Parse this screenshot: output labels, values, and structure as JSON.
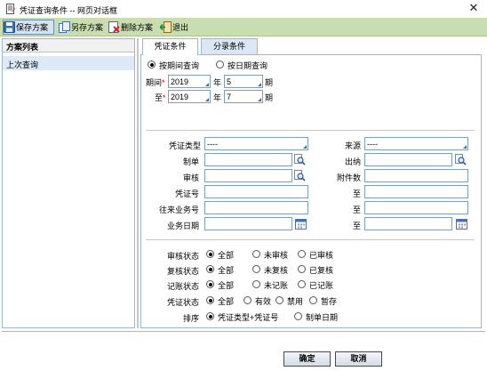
{
  "window": {
    "title": "凭证查询条件 -- 网页对话框",
    "close_glyph": "✕"
  },
  "toolbar": {
    "save": "保存方案",
    "save_as": "另存方案",
    "delete": "删除方案",
    "exit": "退出"
  },
  "sidebar": {
    "header": "方案列表",
    "items": [
      {
        "label": "上次查询"
      }
    ]
  },
  "tabs": [
    {
      "label": "凭证条件"
    },
    {
      "label": "分录条件"
    }
  ],
  "query_mode": {
    "by_period": "按期间查询",
    "by_date": "按日期查询",
    "selected": "by_period"
  },
  "period": {
    "from_label": "期间",
    "to_label": "至",
    "required_mark": "*",
    "year_unit": "年",
    "period_unit": "期",
    "from_year": "2019",
    "from_period": "5",
    "to_year": "2019",
    "to_period": "7"
  },
  "fields": {
    "voucher_type": {
      "label": "凭证类型",
      "value": "----"
    },
    "source": {
      "label": "来源",
      "value": "----"
    },
    "maker": {
      "label": "制单",
      "value": ""
    },
    "cashier": {
      "label": "出纳",
      "value": ""
    },
    "auditor": {
      "label": "审核",
      "value": ""
    },
    "attachments": {
      "label": "附件数",
      "value": ""
    },
    "voucher_no": {
      "label": "凭证号",
      "value": ""
    },
    "voucher_no_to": {
      "label": "至",
      "value": ""
    },
    "counterparty_no": {
      "label": "往来业务号",
      "value": ""
    },
    "counterparty_no_to": {
      "label": "至",
      "value": ""
    },
    "biz_date": {
      "label": "业务日期",
      "value": ""
    },
    "biz_date_to": {
      "label": "至",
      "value": ""
    }
  },
  "status": {
    "audit": {
      "label": "审核状态",
      "options": [
        "全部",
        "未审核",
        "已审核"
      ],
      "selected": 0
    },
    "review": {
      "label": "复核状态",
      "options": [
        "全部",
        "未复核",
        "已复核"
      ],
      "selected": 0
    },
    "posting": {
      "label": "记账状态",
      "options": [
        "全部",
        "未记账",
        "已记账"
      ],
      "selected": 0
    },
    "voucher": {
      "label": "凭证状态",
      "options": [
        "全部",
        "有效",
        "禁用",
        "暂存"
      ],
      "selected": 0
    },
    "sort": {
      "label": "排序",
      "options": [
        "凭证类型+凭证号",
        "制单日期"
      ],
      "selected": 0
    }
  },
  "buttons": {
    "ok": "确定",
    "cancel": "取消"
  },
  "colors": {
    "toolbar_bg": "#c9deb0",
    "panel_border": "#9db7d0",
    "selected_row": "#dde9f7",
    "required": "#d00000"
  }
}
